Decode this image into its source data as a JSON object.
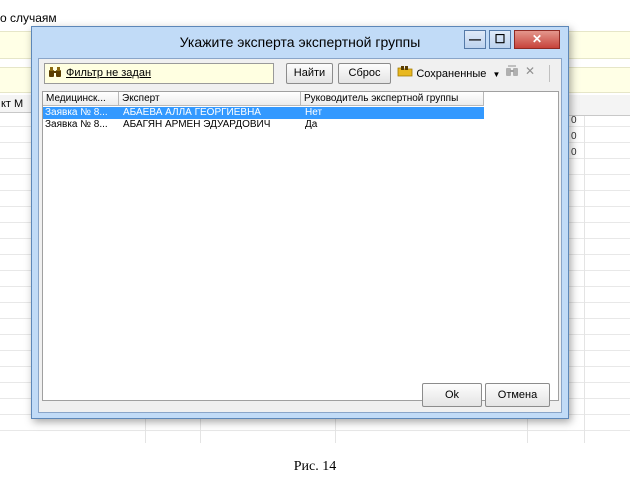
{
  "background": {
    "title_partial": "о случаям",
    "column_header_partial": "кт М",
    "right_glyphs": [
      "0",
      "0",
      "0"
    ]
  },
  "dialog": {
    "title": "Укажите эксперта экспертной группы",
    "window_buttons": {
      "minimize": "—",
      "maximize": "☐",
      "close": "✕"
    },
    "toolbar": {
      "filter_label": "Фильтр не задан",
      "find_label": "Найти",
      "reset_label": "Сброс",
      "saved_label": "Сохраненные",
      "close_glyph": "✕"
    },
    "grid": {
      "columns": [
        "Медицинск...",
        "Эксперт",
        "Руководитель экспертной группы"
      ],
      "rows": [
        {
          "col1": "Заявка № 8...",
          "col2": "АБАЕВА АЛЛА ГЕОРГИЕВНА",
          "col3": "Нет",
          "selected": true
        },
        {
          "col1": "Заявка № 8...",
          "col2": "АБАГЯН АРМЕН ЭДУАРДОВИЧ",
          "col3": "Да",
          "selected": false
        }
      ]
    },
    "ok_label": "Ok",
    "cancel_label": "Отмена"
  },
  "caption": "Рис. 14"
}
